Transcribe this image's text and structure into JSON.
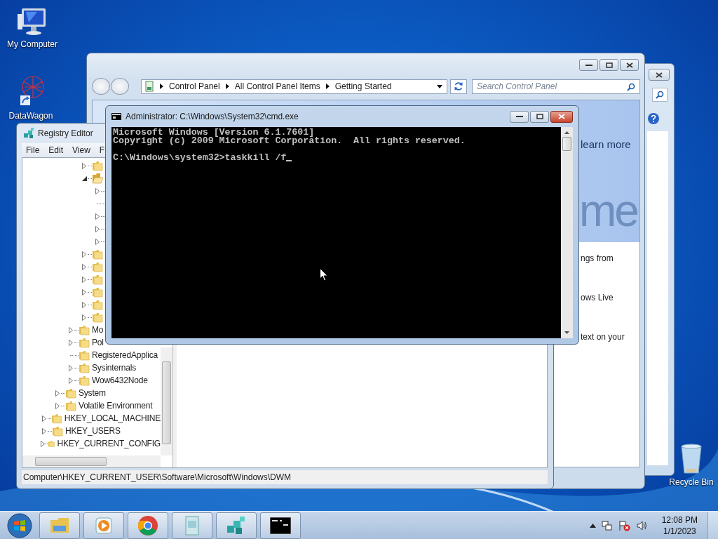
{
  "desktop_icons": [
    {
      "kind": "computer",
      "label": "My Computer"
    },
    {
      "kind": "molecule",
      "label": "DataWagon"
    },
    {
      "kind": "bin",
      "label": "Recycle Bin"
    }
  ],
  "control_panel": {
    "breadcrumb": [
      "Control Panel",
      "All Control Panel Items",
      "Getting Started"
    ],
    "search": {
      "placeholder": "Search Control Panel"
    },
    "content": {
      "link": "learn more",
      "banner": "me",
      "lines": [
        "ngs from",
        "ows Live",
        "text on your"
      ]
    }
  },
  "registry_editor": {
    "title": "Registry Editor",
    "menu": [
      "File",
      "Edit",
      "View",
      "F"
    ],
    "tree": [
      {
        "kind": "offscreen",
        "children": [
          {
            "kind": "offscreen",
            "children": [
              {
                "kind": "offscreen",
                "children": [
                  {
                    "kind": "key",
                    "leaf": false,
                    "expanded": false
                  },
                  {
                    "kind": "key",
                    "leaf": false,
                    "expanded": true,
                    "children": [
                      {
                        "kind": "key",
                        "leaf": false,
                        "expanded": false
                      },
                      {
                        "kind": "key",
                        "leaf": true
                      },
                      {
                        "kind": "key",
                        "leaf": false,
                        "expanded": false
                      },
                      {
                        "kind": "key",
                        "leaf": false,
                        "expanded": false
                      },
                      {
                        "kind": "key",
                        "leaf": false,
                        "expanded": false
                      }
                    ]
                  },
                  {
                    "kind": "key",
                    "leaf": false,
                    "expanded": false
                  },
                  {
                    "kind": "key",
                    "leaf": false,
                    "expanded": false
                  },
                  {
                    "kind": "key",
                    "leaf": false,
                    "expanded": false
                  },
                  {
                    "kind": "key",
                    "leaf": false,
                    "expanded": false
                  },
                  {
                    "kind": "key",
                    "leaf": false,
                    "expanded": false
                  },
                  {
                    "kind": "key",
                    "leaf": false,
                    "expanded": false
                  }
                ]
              },
              {
                "kind": "key",
                "leaf": false,
                "expanded": false,
                "label": "Mo"
              },
              {
                "kind": "key",
                "leaf": false,
                "expanded": false,
                "label": "Pol"
              },
              {
                "kind": "key",
                "leaf": true,
                "label": "RegisteredApplica"
              },
              {
                "kind": "key",
                "leaf": false,
                "expanded": false,
                "label": "Sysinternals"
              },
              {
                "kind": "key",
                "leaf": false,
                "expanded": false,
                "label": "Wow6432Node"
              }
            ]
          },
          {
            "kind": "key",
            "leaf": false,
            "expanded": false,
            "label": "System"
          },
          {
            "kind": "key",
            "leaf": false,
            "expanded": false,
            "label": "Volatile Environment"
          }
        ]
      },
      {
        "kind": "key",
        "leaf": false,
        "expanded": false,
        "label": "HKEY_LOCAL_MACHINE"
      },
      {
        "kind": "key",
        "leaf": false,
        "expanded": false,
        "label": "HKEY_USERS"
      },
      {
        "kind": "key",
        "leaf": false,
        "expanded": false,
        "label": "HKEY_CURRENT_CONFIG"
      }
    ],
    "status_bar": "Computer\\HKEY_CURRENT_USER\\Software\\Microsoft\\Windows\\DWM"
  },
  "cmd": {
    "title": "Administrator: C:\\Windows\\System32\\cmd.exe",
    "output": [
      "Microsoft Windows [Version 6.1.7601]",
      "Copyright (c) 2009 Microsoft Corporation.  All rights reserved."
    ],
    "prompt": "C:\\Windows\\system32>taskkill /f"
  },
  "taskbar": {
    "buttons": [
      {
        "kind": "explorer"
      },
      {
        "kind": "media"
      },
      {
        "kind": "chrome"
      },
      {
        "kind": "document"
      },
      {
        "kind": "regedit"
      },
      {
        "kind": "cmd"
      }
    ],
    "clock": {
      "time": "12:08 PM",
      "date": "1/1/2023"
    }
  }
}
